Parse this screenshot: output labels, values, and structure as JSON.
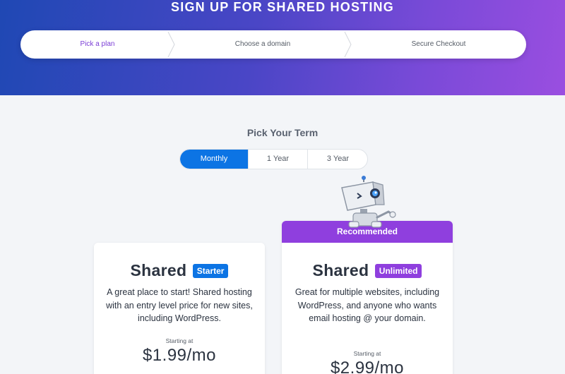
{
  "header": {
    "title": "SIGN UP FOR SHARED HOSTING",
    "steps": [
      {
        "label": "Pick a plan"
      },
      {
        "label": "Choose a domain"
      },
      {
        "label": "Secure Checkout"
      }
    ],
    "active_step": "Pick a plan"
  },
  "term": {
    "title": "Pick Your Term",
    "options": [
      "Monthly",
      "1 Year",
      "3 Year"
    ],
    "selected": "Monthly"
  },
  "plans": [
    {
      "name": "Shared",
      "badge": "Starter",
      "description": "A great place to start! Shared hosting with an entry level price for new sites, including WordPress.",
      "starting_label": "Starting at",
      "price": "$1.99/mo"
    },
    {
      "banner": "Recommended",
      "name": "Shared",
      "badge": "Unlimited",
      "description": "Great for multiple websites, including WordPress, and anyone who wants email hosting @ your domain.",
      "starting_label": "Starting at",
      "price": "$2.99/mo"
    }
  ],
  "colors": {
    "accent_blue": "#0c74e4",
    "accent_purple": "#8f3fde",
    "hero_start": "#1f48b4",
    "hero_end": "#9a4ee0"
  },
  "icons": {
    "mascot": "robot-mascot-icon",
    "step_separator": "chevron-right-icon"
  }
}
